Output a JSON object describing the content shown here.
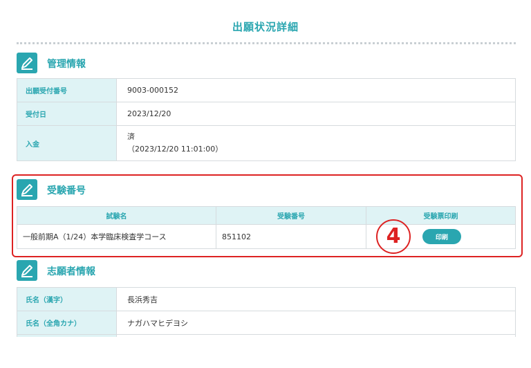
{
  "page": {
    "title": "出願状況詳細"
  },
  "management": {
    "title": "管理情報",
    "icon": "pencil-icon",
    "rows": [
      {
        "label": "出願受付番号",
        "value": "9003-000152"
      },
      {
        "label": "受付日",
        "value": "2023/12/20"
      },
      {
        "label": "入金",
        "value": "済",
        "value2": "（2023/12/20 11:01:00）"
      }
    ]
  },
  "exam": {
    "title": "受験番号",
    "icon": "pencil-icon",
    "headers": [
      "試験名",
      "受験番号",
      "受験票印刷"
    ],
    "row": {
      "name": "一般前期A（1/24）本学臨床検査学コース",
      "number": "851102",
      "print_label": "印刷"
    }
  },
  "annotation": {
    "step": "4",
    "color": "#dd2222"
  },
  "applicant": {
    "title": "志願者情報",
    "icon": "pencil-icon",
    "rows": [
      {
        "label": "氏名（漢字）",
        "value": "長浜秀吉"
      },
      {
        "label": "氏名（全角カナ）",
        "value": "ナガハマヒデヨシ"
      }
    ]
  },
  "colors": {
    "accent": "#2aa6b0",
    "header_bg": "#dff3f5",
    "highlight": "#dd2222"
  }
}
